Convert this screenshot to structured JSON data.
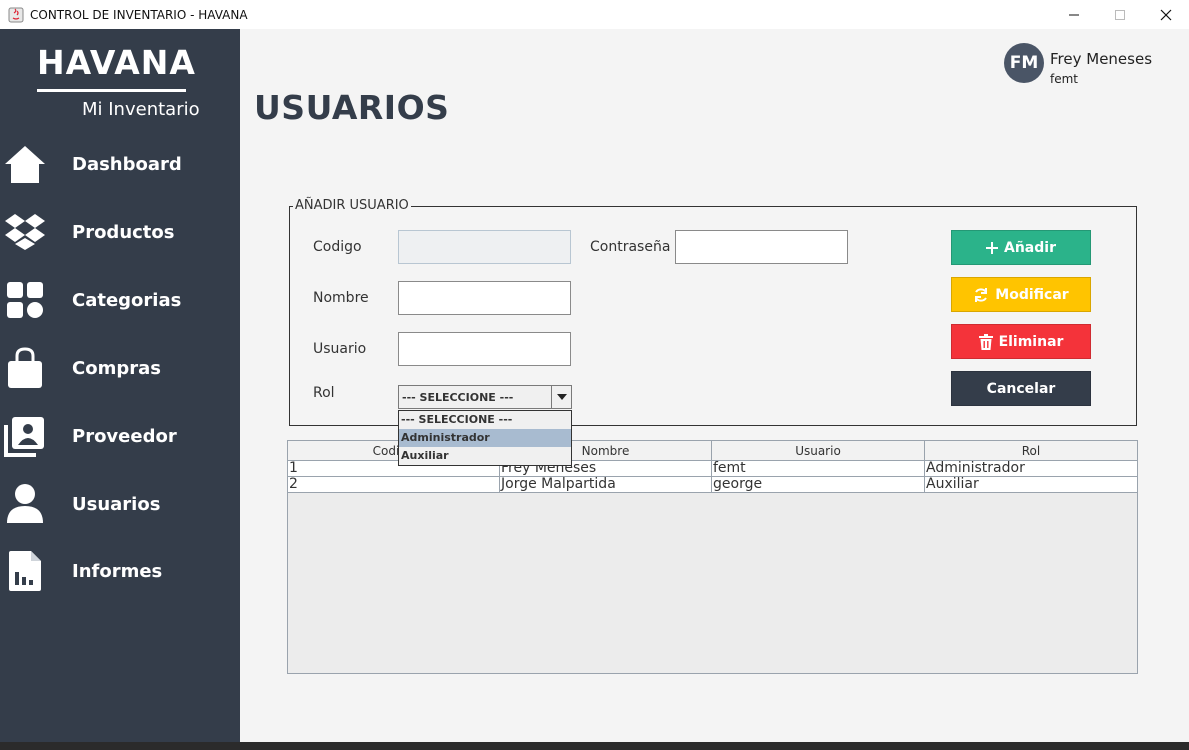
{
  "window": {
    "title": "CONTROL DE INVENTARIO - HAVANA",
    "minimize": "minimize",
    "maximize": "maximize",
    "close": "close"
  },
  "brand": {
    "name": "HAVANA",
    "subtitle": "Mi Inventario"
  },
  "sidebar": {
    "items": [
      {
        "label": "Dashboard",
        "icon": "home-icon"
      },
      {
        "label": "Productos",
        "icon": "dropbox-icon"
      },
      {
        "label": "Categorias",
        "icon": "grid-icon"
      },
      {
        "label": "Compras",
        "icon": "shopping-bag-icon"
      },
      {
        "label": "Proveedor",
        "icon": "contact-card-icon"
      },
      {
        "label": "Usuarios",
        "icon": "user-icon"
      },
      {
        "label": "Informes",
        "icon": "report-icon"
      }
    ]
  },
  "user": {
    "initials": "FM",
    "name": "Frey Meneses",
    "login": "femt"
  },
  "page": {
    "title": "USUARIOS"
  },
  "form": {
    "legend": "AÑADIR USUARIO",
    "codigo_label": "Codigo",
    "codigo_value": "",
    "contrasena_label": "Contraseña",
    "contrasena_value": "",
    "nombre_label": "Nombre",
    "nombre_value": "",
    "usuario_label": "Usuario",
    "usuario_value": "",
    "rol_label": "Rol",
    "rol_selected": "--- SELECCIONE ---",
    "rol_options": [
      "--- SELECCIONE ---",
      "Administrador",
      "Auxiliar"
    ],
    "rol_highlighted": "Administrador"
  },
  "buttons": {
    "anadir": "Añadir",
    "modificar": "Modificar",
    "eliminar": "Eliminar",
    "cancelar": "Cancelar"
  },
  "colors": {
    "sidebar": "#343d4a",
    "anadir": "#2bb38a",
    "modificar": "#ffc400",
    "eliminar": "#f4333a",
    "cancelar": "#343d4a"
  },
  "table": {
    "columns": [
      "Codigo",
      "Nombre",
      "Usuario",
      "Rol"
    ],
    "rows": [
      [
        "1",
        "Frey Meneses",
        "femt",
        "Administrador"
      ],
      [
        "2",
        "Jorge Malpartida",
        "george",
        "Auxiliar"
      ]
    ]
  }
}
